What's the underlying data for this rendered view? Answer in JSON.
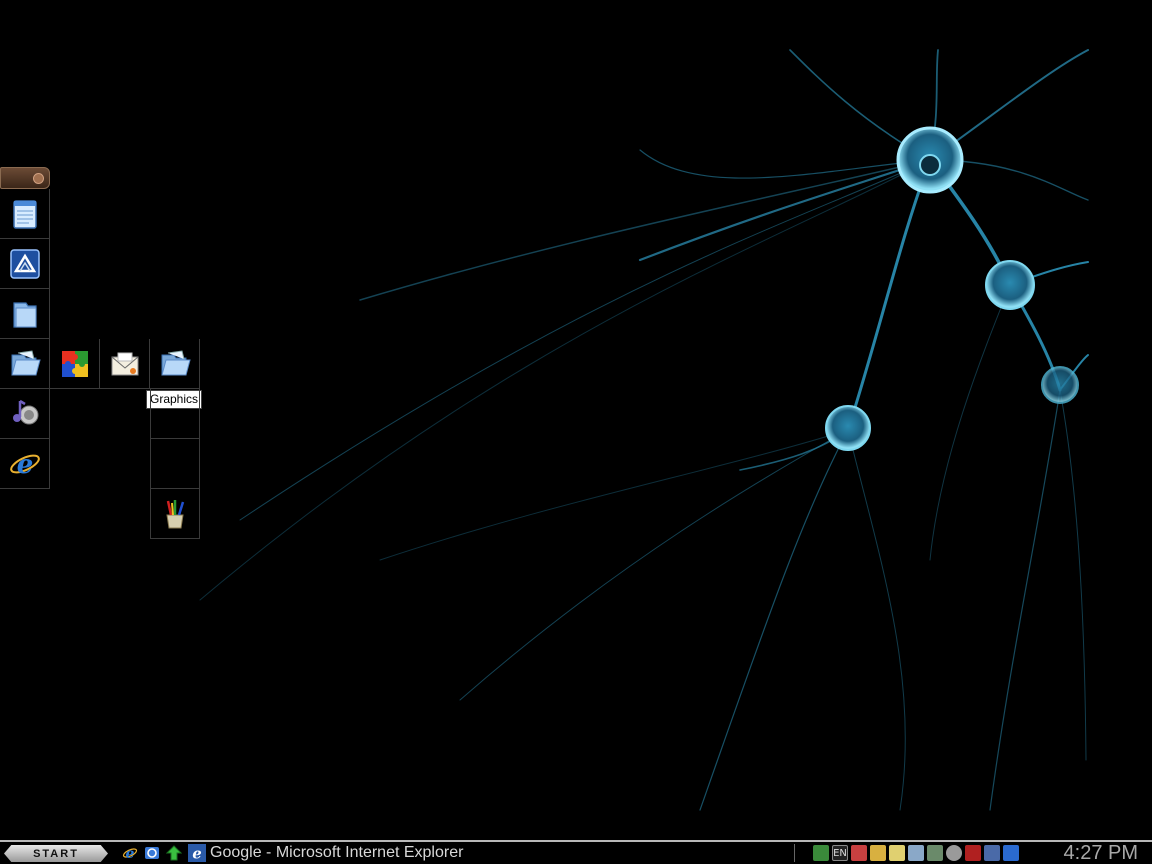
{
  "desktop": {
    "wallpaper": "neuron-wallpaper",
    "accent_color": "#3fb8d8"
  },
  "dock": {
    "tooltip": "Graphics",
    "icons": [
      {
        "name": "notepad-icon"
      },
      {
        "name": "app-launcher-icon"
      },
      {
        "name": "folder-icon"
      },
      {
        "name": "folder-open-icon"
      },
      {
        "name": "puzzle-icon"
      },
      {
        "name": "mail-icon"
      },
      {
        "name": "graphics-folder-icon"
      },
      {
        "name": "media-player-icon"
      },
      {
        "name": "internet-explorer-icon"
      },
      {
        "name": "paint-brushes-icon"
      }
    ]
  },
  "taskbar": {
    "start_label": "START",
    "active_window": "Google - Microsoft Internet Explorer",
    "tray": {
      "language": "EN"
    },
    "clock": "4:27 PM"
  }
}
